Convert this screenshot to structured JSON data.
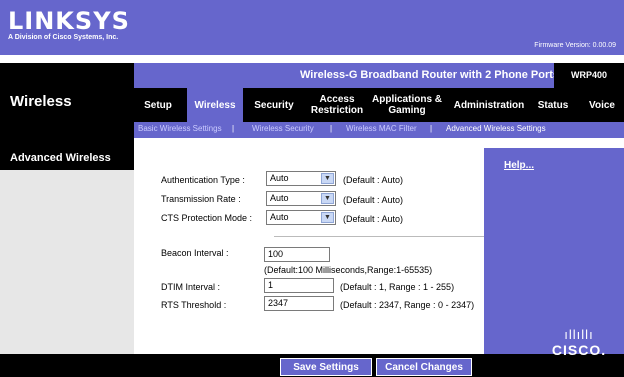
{
  "header": {
    "logo": "LINKSYS",
    "logo_sub": "A Division of Cisco Systems, Inc.",
    "firmware": "Firmware Version: 0.00.09"
  },
  "section": {
    "title": "Wireless"
  },
  "product": {
    "name": "Wireless-G Broadband Router with 2 Phone Ports",
    "model": "WRP400"
  },
  "tabs": [
    {
      "label": "Setup"
    },
    {
      "label": "Wireless"
    },
    {
      "label": "Security"
    },
    {
      "label": "Access Restriction"
    },
    {
      "label": "Applications & Gaming"
    },
    {
      "label": "Administration"
    },
    {
      "label": "Status"
    },
    {
      "label": "Voice"
    }
  ],
  "subtabs": [
    {
      "label": "Basic Wireless Settings"
    },
    {
      "label": "Wireless Security"
    },
    {
      "label": "Wireless MAC Filter"
    },
    {
      "label": "Advanced Wireless Settings"
    }
  ],
  "panel": {
    "heading": "Advanced Wireless"
  },
  "form": {
    "auth_type": {
      "label": "Authentication Type :",
      "value": "Auto",
      "hint": "(Default : Auto)"
    },
    "tx_rate": {
      "label": "Transmission Rate :",
      "value": "Auto",
      "hint": "(Default : Auto)"
    },
    "cts": {
      "label": "CTS Protection Mode :",
      "value": "Auto",
      "hint": "(Default : Auto)"
    },
    "beacon": {
      "label": "Beacon Interval :",
      "value": "100",
      "hint": "(Default:100 Milliseconds,Range:1-65535)"
    },
    "dtim": {
      "label": "DTIM Interval :",
      "value": "1",
      "hint": "(Default : 1, Range : 1 - 255)"
    },
    "rts": {
      "label": "RTS Threshold :",
      "value": "2347",
      "hint": "(Default : 2347, Range : 0 - 2347)"
    }
  },
  "help": {
    "label": "Help..."
  },
  "buttons": {
    "save": "Save Settings",
    "cancel": "Cancel Changes"
  },
  "brand": {
    "cisco": "CISCO."
  },
  "colors": {
    "primary": "#6666cc",
    "black": "#000000"
  }
}
